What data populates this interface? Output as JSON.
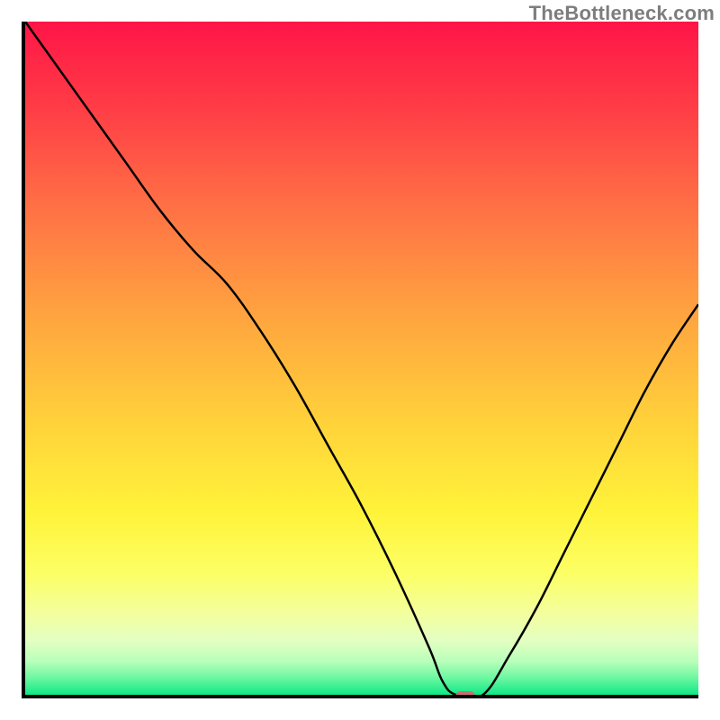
{
  "watermark": "TheBottleneck.com",
  "chart_data": {
    "type": "line",
    "title": "",
    "xlabel": "",
    "ylabel": "",
    "xlim": [
      0,
      100
    ],
    "ylim": [
      0,
      100
    ],
    "grid": false,
    "series": [
      {
        "name": "bottleneck-curve",
        "x": [
          0,
          5,
          10,
          15,
          20,
          25,
          30,
          35,
          40,
          45,
          50,
          55,
          60,
          62,
          64,
          68,
          72,
          76,
          80,
          84,
          88,
          92,
          96,
          100
        ],
        "y": [
          100,
          93,
          86,
          79,
          72,
          66,
          61,
          54,
          46,
          37,
          28,
          18,
          7,
          2,
          0,
          0,
          6,
          13,
          21,
          29,
          37,
          45,
          52,
          58
        ]
      }
    ],
    "marker": {
      "x": 65,
      "y": 0,
      "color": "#c77070"
    },
    "gradient_stops": [
      {
        "pct": 0,
        "color": "#ff1547"
      },
      {
        "pct": 12,
        "color": "#ff3a46"
      },
      {
        "pct": 28,
        "color": "#ff7245"
      },
      {
        "pct": 44,
        "color": "#ffa53f"
      },
      {
        "pct": 60,
        "color": "#ffd33a"
      },
      {
        "pct": 73,
        "color": "#fff33a"
      },
      {
        "pct": 82,
        "color": "#fcff65"
      },
      {
        "pct": 88,
        "color": "#f3ff9e"
      },
      {
        "pct": 92,
        "color": "#e3ffc2"
      },
      {
        "pct": 95,
        "color": "#b9ffba"
      },
      {
        "pct": 97.5,
        "color": "#6cf7a1"
      },
      {
        "pct": 100,
        "color": "#0ee886"
      }
    ]
  }
}
